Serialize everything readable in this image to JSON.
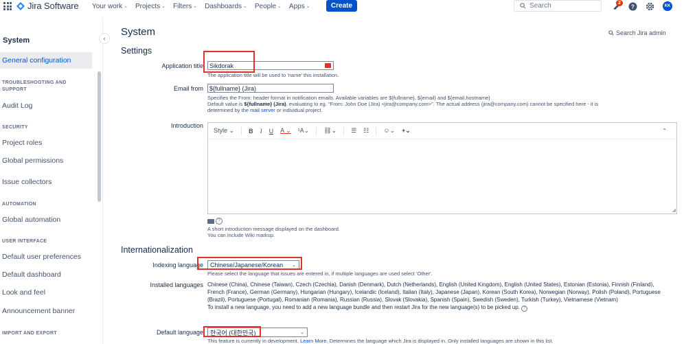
{
  "topnav": {
    "app_name": "Jira Software",
    "items": [
      {
        "label": "Your work"
      },
      {
        "label": "Projects"
      },
      {
        "label": "Filters"
      },
      {
        "label": "Dashboards"
      },
      {
        "label": "People"
      },
      {
        "label": "Apps"
      }
    ],
    "create_label": "Create",
    "search_placeholder": "Search",
    "notification_count": "2",
    "avatar_initials": "KK"
  },
  "sidebar": {
    "title": "System",
    "active_item": "General configuration",
    "headings": {
      "troubleshooting_line1": "TROUBLESHOOTING AND",
      "troubleshooting_line2": "SUPPORT",
      "security": "SECURITY",
      "automation": "AUTOMATION",
      "user_interface": "USER INTERFACE",
      "import_export": "IMPORT AND EXPORT"
    },
    "items": {
      "audit_log": "Audit Log",
      "project_roles": "Project roles",
      "global_permissions": "Global permissions",
      "issue_collectors": "Issue collectors",
      "global_automation": "Global automation",
      "default_user_preferences": "Default user preferences",
      "default_dashboard": "Default dashboard",
      "look_and_feel": "Look and feel",
      "announcement_banner": "Announcement banner"
    }
  },
  "main": {
    "title": "System",
    "search_admin": "Search Jira admin",
    "settings_title": "Settings",
    "i18n_title": "Internationalization",
    "app_title": {
      "label": "Application title",
      "value": "Sikdorak",
      "help": "The application title will be used to 'name' this installation."
    },
    "email_from": {
      "label": "Email from",
      "value": "${fullname} (Jira)",
      "help1": "Specifies the From: header format in notification emails. Available variables are ${fullname}, ${email} and ${email.hostname}",
      "help2_prefix": "Default value is ",
      "help2_bold": "${fullname} (Jira)",
      "help2_suffix": ", evaluating to eg. \"From: John Doe (Jira) <jira@company.com>\". The actual address (jira@company.com) cannot be specified here - it is",
      "help3_prefix": "determined by the ",
      "help3_link": "mail server",
      "help3_suffix": " or individual project."
    },
    "introduction": {
      "label": "Introduction",
      "toolbar": {
        "style": "Style",
        "bold": "B",
        "italic": "I",
        "underline": "U",
        "color": "A",
        "size": "¹A",
        "link": "🔗",
        "bullets": "☰",
        "numbers": "☰",
        "emoji": "☺",
        "plus": "+",
        "collapse": "⌃"
      },
      "help1": "A short introduction message displayed on the dashboard.",
      "help2": "You can include Wiki markup."
    },
    "indexing_language": {
      "label": "Indexing language",
      "value": "Chinese/Japanese/Korean",
      "help": "Please select the language that issues are entered in, if multiple languages are used select 'Other'."
    },
    "installed_languages": {
      "label": "Installed languages",
      "text": "Chinese (China), Chinese (Taiwan), Czech (Czechia), Danish (Denmark), Dutch (Netherlands), English (United Kingdom), English (United States), Estonian (Estonia), Finnish (Finland), French (France), German (Germany), Hungarian (Hungary), Icelandic (Iceland), Italian (Italy), Japanese (Japan), Korean (South Korea), Norwegian (Norway), Polish (Poland), Portuguese (Brazil), Portuguese (Portugal), Romanian (Romania), Russian (Russia), Slovak (Slovakia), Spanish (Spain), Swedish (Sweden), Turkish (Turkey), Vietnamese (Vietnam)",
      "help": "To install a new language, you need to add a new language bundle and then restart Jira for the new language(s) to be picked up."
    },
    "default_language": {
      "label": "Default language",
      "value": "한국어 (대한민국)",
      "help_prefix": "This feature is currently in development. ",
      "help_link": "Learn More",
      "help_suffix": ". Determines the language which Jira is displayed in. Only installed languages are shown in this list."
    }
  },
  "colors": {
    "primary": "#0052cc",
    "highlight_box": "#e5302a",
    "text": "#172b4d"
  }
}
